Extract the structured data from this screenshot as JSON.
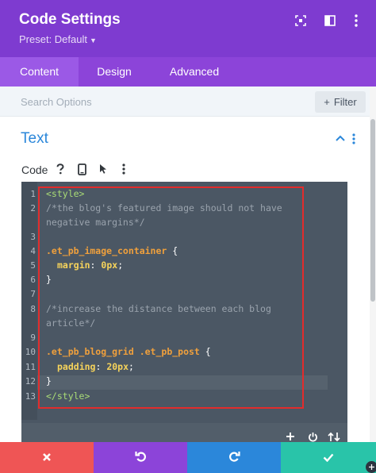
{
  "header": {
    "title": "Code Settings",
    "preset": "Preset: Default",
    "bg_color": "#7e3bd0",
    "icons": [
      "expand-icon",
      "split-view-icon",
      "more-vertical-icon"
    ]
  },
  "tabs": [
    {
      "label": "Content",
      "active": true
    },
    {
      "label": "Design",
      "active": false
    },
    {
      "label": "Advanced",
      "active": false
    }
  ],
  "search": {
    "placeholder": "Search Options",
    "filter_label": "Filter"
  },
  "section": {
    "title": "Text"
  },
  "field": {
    "label": "Code",
    "icons": [
      "help-icon",
      "mobile-icon",
      "cursor-icon",
      "more-vertical-icon"
    ]
  },
  "editor": {
    "line_numbers": [
      "1",
      "2",
      "3",
      "4",
      "5",
      "6",
      "7",
      "8",
      "9",
      "10",
      "11",
      "12",
      "13"
    ],
    "lines": {
      "l1": "<style>",
      "l2": "/*the blog's featured image should not have",
      "l2b": "negative margins*/",
      "l4_sel": ".et_pb_image_container",
      "l4_brace": " {",
      "l5_prop": "margin",
      "l5_colon": ": ",
      "l5_val": "0px",
      "l5_semi": ";",
      "l6": "}",
      "l8": "/*increase the distance between each blog",
      "l8b": "article*/",
      "l10_sel": ".et_pb_blog_grid .et_pb_post",
      "l10_brace": " {",
      "l11_prop": "padding",
      "l11_colon": ": ",
      "l11_val": "20px",
      "l11_semi": ";",
      "l12": "}",
      "l13": "</style>"
    },
    "toolbar_icons": [
      "add-icon",
      "power-icon",
      "sort-icon"
    ]
  },
  "footer": {
    "buttons": [
      {
        "name": "cancel",
        "icon": "close-icon",
        "color": "#ef5555"
      },
      {
        "name": "undo",
        "icon": "undo-icon",
        "color": "#8c44d9"
      },
      {
        "name": "redo",
        "icon": "redo-icon",
        "color": "#2b87da"
      },
      {
        "name": "save",
        "icon": "check-icon",
        "color": "#29c4a9"
      }
    ]
  }
}
